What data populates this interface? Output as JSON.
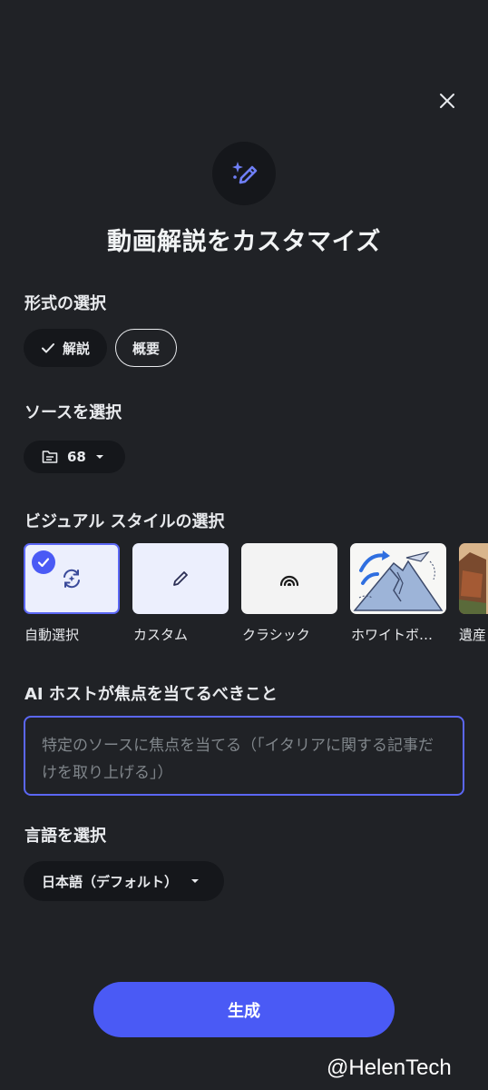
{
  "dialog": {
    "title": "動画解説をカスタマイズ",
    "close_icon": "close-icon",
    "hero_icon": "sparkle-pen-icon"
  },
  "format": {
    "label": "形式の選択",
    "options": [
      {
        "label": "解説",
        "selected": true,
        "icon": "check-icon"
      },
      {
        "label": "概要",
        "selected": false
      }
    ]
  },
  "source": {
    "label": "ソースを選択",
    "count": "68",
    "icon": "folder-icon"
  },
  "visual_style": {
    "label": "ビジュアル スタイルの選択",
    "options": [
      {
        "label": "自動選択",
        "icon": "auto-refresh-icon",
        "selected": true
      },
      {
        "label": "カスタム",
        "icon": "pencil-icon",
        "selected": false
      },
      {
        "label": "クラシック",
        "icon": "arc-icon",
        "selected": false
      },
      {
        "label": "ホワイトボ…",
        "icon": "whiteboard-thumbnail",
        "selected": false
      },
      {
        "label": "遺産",
        "icon": "heritage-thumbnail",
        "selected": false
      }
    ]
  },
  "focus": {
    "label": "AI ホストが焦点を当てるべきこと",
    "placeholder": "特定のソースに焦点を当てる（「イタリアに関する記事だけを取り上げる」）"
  },
  "language": {
    "label": "言語を選択",
    "value": "日本語（デフォルト）"
  },
  "generate_label": "生成",
  "watermark": "@HelenTech",
  "colors": {
    "background": "#202226",
    "accent": "#4a5af5",
    "selected_card_border": "#5b67f5"
  }
}
